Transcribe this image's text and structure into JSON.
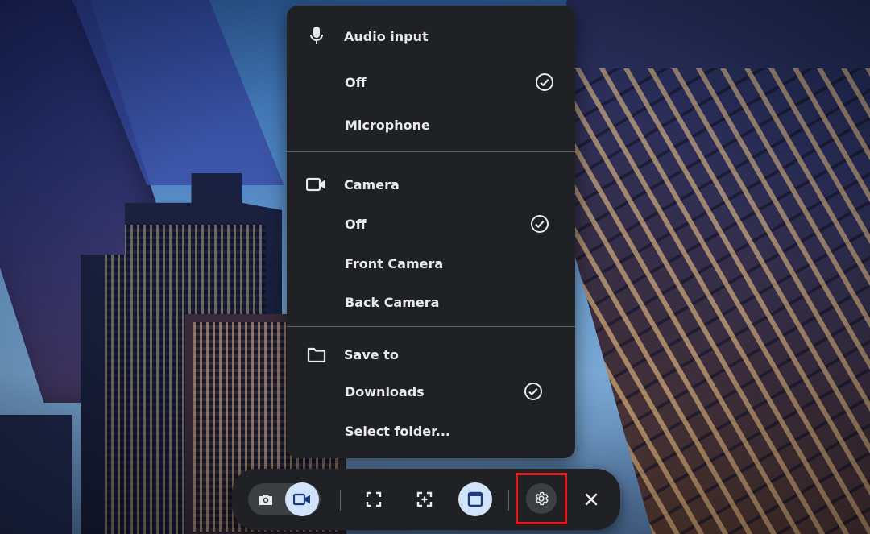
{
  "settings_menu": {
    "audio": {
      "header": "Audio input",
      "options": [
        {
          "label": "Off",
          "selected": true
        },
        {
          "label": "Microphone",
          "selected": false
        }
      ]
    },
    "camera": {
      "header": "Camera",
      "options": [
        {
          "label": "Off",
          "selected": true
        },
        {
          "label": "Front Camera",
          "selected": false
        },
        {
          "label": "Back Camera",
          "selected": false
        }
      ]
    },
    "save_to": {
      "header": "Save to",
      "options": [
        {
          "label": "Downloads",
          "selected": true
        },
        {
          "label": "Select folder...",
          "selected": false
        }
      ]
    }
  },
  "capture_bar": {
    "mode_toggle": {
      "photo": "camera-icon",
      "video": "videocam-icon",
      "active": "video"
    },
    "capture_types": [
      "fullscreen-icon",
      "partial-icon",
      "window-icon"
    ],
    "active_capture_type": "window",
    "settings_icon": "gear-icon",
    "close_icon": "close-icon",
    "highlight_color": "#e11a1a"
  },
  "colors": {
    "menu_bg": "#202124",
    "text": "#e8eaed",
    "divider": "#5f6368",
    "selected_chip": "#d2e3fc"
  }
}
